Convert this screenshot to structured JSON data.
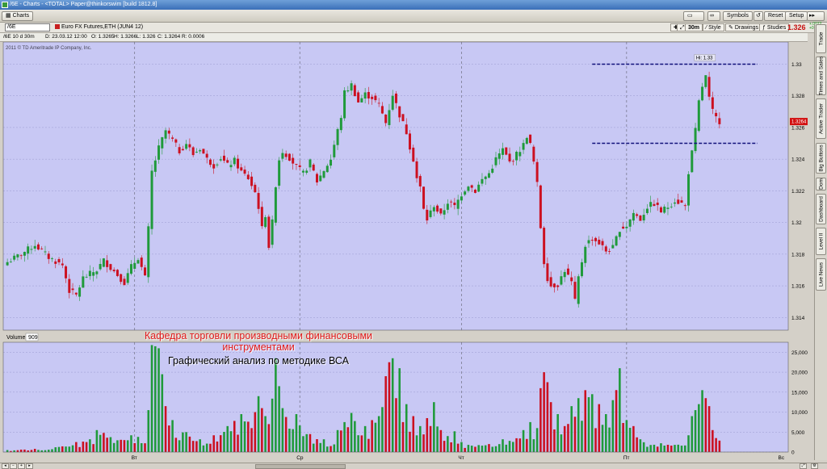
{
  "window": {
    "title": "/6E - Charts - <TOTAL> Paper@thinkorswim [build 1812.8]"
  },
  "toolbar": {
    "charts_tab": "Charts",
    "symbols_label": "Symbols",
    "reset_label": "Reset",
    "setup_label": "Setup"
  },
  "symbolbar": {
    "symbol": "/6E",
    "description": "Euro FX Futures,ETH (JUN4 12)",
    "timeframe": "30m",
    "style_label": "Style",
    "drawings_label": "Drawings",
    "studies_label": "Studies",
    "last_price": "1.326",
    "change_top": "+.0072",
    "change_bottom": "+0.55%"
  },
  "infobar": {
    "period": "/6E 10 d 30m",
    "date": "D: 23.03.12 12:00",
    "open": "O: 1.3265",
    "high": "H: 1.3266",
    "low": "L: 1.326",
    "close": "C: 1.3264",
    "range": "R: 0.0006"
  },
  "copyright": "2011 © TD Ameritrade IP Company, Inc.",
  "overlay": {
    "line1": "Кафедра торговли производными финансовыми",
    "line2": "инструментами",
    "line3": "Графический анализ по методике ВСА"
  },
  "side_tabs": [
    "Trade",
    "Times and Sales",
    "Active Trader",
    "Big Buttons",
    "Dom",
    "Dashboard",
    "Level II",
    "Live News"
  ],
  "colors": {
    "plot_bg": "#c8c8f4",
    "up": "#1f9a3a",
    "down": "#cc1020",
    "level_line": "#10107a",
    "price_badge": "#d21010"
  },
  "chart_data": {
    "type": "candlestick",
    "price_axis_ticks": [
      "1.33",
      "1.328",
      "1.326",
      "1.324",
      "1.322",
      "1.32",
      "1.318",
      "1.316",
      "1.314"
    ],
    "ylim": [
      1.3132,
      1.3314
    ],
    "current_price": "1.3264",
    "high_label": "Hi: 1.33",
    "levels": [
      1.33,
      1.325
    ],
    "day_labels": [
      "Вт",
      "Ср",
      "Чт",
      "Пт",
      "Вс"
    ],
    "volume_label": "Volume",
    "volume_value": "909",
    "volume_axis_ticks": [
      "25,000",
      "20,000",
      "15,000",
      "10,000",
      "5,000",
      "0"
    ],
    "volume_ylim": [
      0,
      27500
    ],
    "path": [
      [
        0,
        1.3175
      ],
      [
        4,
        1.318
      ],
      [
        8,
        1.3186
      ],
      [
        12,
        1.3178
      ],
      [
        16,
        1.3173
      ],
      [
        18,
        1.3157
      ],
      [
        20,
        1.3154
      ],
      [
        22,
        1.3165
      ],
      [
        26,
        1.317
      ],
      [
        28,
        1.3176
      ],
      [
        32,
        1.3167
      ],
      [
        34,
        1.3162
      ],
      [
        36,
        1.3172
      ],
      [
        38,
        1.3178
      ],
      [
        40,
        1.3165
      ],
      [
        41,
        1.3196
      ],
      [
        42,
        1.3232
      ],
      [
        44,
        1.3247
      ],
      [
        46,
        1.3258
      ],
      [
        48,
        1.3252
      ],
      [
        50,
        1.3245
      ],
      [
        52,
        1.325
      ],
      [
        54,
        1.3243
      ],
      [
        56,
        1.3247
      ],
      [
        58,
        1.324
      ],
      [
        60,
        1.3236
      ],
      [
        62,
        1.3241
      ],
      [
        64,
        1.3236
      ],
      [
        66,
        1.3239
      ],
      [
        68,
        1.3232
      ],
      [
        70,
        1.3228
      ],
      [
        72,
        1.3219
      ],
      [
        73,
        1.321
      ],
      [
        74,
        1.3196
      ],
      [
        75,
        1.3205
      ],
      [
        76,
        1.3185
      ],
      [
        77,
        1.32
      ],
      [
        78,
        1.3224
      ],
      [
        79,
        1.324
      ],
      [
        80,
        1.3245
      ],
      [
        82,
        1.3241
      ],
      [
        84,
        1.3235
      ],
      [
        86,
        1.3231
      ],
      [
        88,
        1.3238
      ],
      [
        90,
        1.3226
      ],
      [
        92,
        1.3233
      ],
      [
        94,
        1.324
      ],
      [
        96,
        1.3258
      ],
      [
        97,
        1.3267
      ],
      [
        98,
        1.3282
      ],
      [
        100,
        1.3287
      ],
      [
        102,
        1.3276
      ],
      [
        104,
        1.3281
      ],
      [
        106,
        1.3279
      ],
      [
        108,
        1.3274
      ],
      [
        110,
        1.3263
      ],
      [
        112,
        1.3281
      ],
      [
        114,
        1.3268
      ],
      [
        116,
        1.3257
      ],
      [
        117,
        1.3248
      ],
      [
        118,
        1.324
      ],
      [
        119,
        1.3228
      ],
      [
        120,
        1.3222
      ],
      [
        121,
        1.3208
      ],
      [
        122,
        1.3202
      ],
      [
        124,
        1.3211
      ],
      [
        126,
        1.3204
      ],
      [
        128,
        1.3213
      ],
      [
        130,
        1.321
      ],
      [
        132,
        1.3218
      ],
      [
        134,
        1.3224
      ],
      [
        136,
        1.322
      ],
      [
        138,
        1.3227
      ],
      [
        140,
        1.3231
      ],
      [
        142,
        1.324
      ],
      [
        144,
        1.3246
      ],
      [
        146,
        1.3238
      ],
      [
        148,
        1.3243
      ],
      [
        150,
        1.3249
      ],
      [
        151,
        1.3255
      ],
      [
        152,
        1.3249
      ],
      [
        153,
        1.3238
      ],
      [
        154,
        1.3224
      ],
      [
        155,
        1.3197
      ],
      [
        156,
        1.3175
      ],
      [
        157,
        1.3165
      ],
      [
        158,
        1.316
      ],
      [
        160,
        1.3161
      ],
      [
        162,
        1.317
      ],
      [
        164,
        1.3162
      ],
      [
        165,
        1.315
      ],
      [
        166,
        1.3165
      ],
      [
        168,
        1.3186
      ],
      [
        170,
        1.319
      ],
      [
        172,
        1.3187
      ],
      [
        174,
        1.3182
      ],
      [
        176,
        1.3184
      ],
      [
        178,
        1.3196
      ],
      [
        180,
        1.3198
      ],
      [
        182,
        1.3206
      ],
      [
        184,
        1.3202
      ],
      [
        186,
        1.321
      ],
      [
        188,
        1.3212
      ],
      [
        190,
        1.3207
      ],
      [
        192,
        1.321
      ],
      [
        194,
        1.3214
      ],
      [
        196,
        1.3212
      ],
      [
        197,
        1.321
      ],
      [
        198,
        1.3232
      ],
      [
        199,
        1.3244
      ],
      [
        200,
        1.3258
      ],
      [
        201,
        1.3276
      ],
      [
        202,
        1.3286
      ],
      [
        203,
        1.3292
      ],
      [
        204,
        1.3278
      ],
      [
        205,
        1.327
      ],
      [
        206,
        1.3266
      ],
      [
        207,
        1.3264
      ]
    ],
    "volumes": [
      [
        0,
        500
      ],
      [
        8,
        800
      ],
      [
        14,
        1200
      ],
      [
        20,
        2500
      ],
      [
        24,
        3200
      ],
      [
        26,
        5500
      ],
      [
        28,
        4800
      ],
      [
        34,
        3000
      ],
      [
        36,
        4200
      ],
      [
        38,
        3800
      ],
      [
        40,
        2200
      ],
      [
        42,
        26800
      ],
      [
        43,
        26500
      ],
      [
        44,
        26000
      ],
      [
        45,
        19500
      ],
      [
        46,
        11500
      ],
      [
        48,
        8000
      ],
      [
        52,
        5000
      ],
      [
        56,
        3200
      ],
      [
        60,
        4200
      ],
      [
        64,
        6500
      ],
      [
        66,
        7800
      ],
      [
        68,
        9500
      ],
      [
        70,
        7600
      ],
      [
        72,
        10000
      ],
      [
        73,
        14000
      ],
      [
        74,
        11000
      ],
      [
        75,
        9000
      ],
      [
        76,
        7000
      ],
      [
        78,
        23500
      ],
      [
        79,
        16500
      ],
      [
        80,
        11000
      ],
      [
        84,
        9500
      ],
      [
        88,
        4500
      ],
      [
        92,
        3200
      ],
      [
        94,
        1500
      ],
      [
        96,
        5500
      ],
      [
        98,
        7500
      ],
      [
        100,
        9800
      ],
      [
        104,
        6500
      ],
      [
        106,
        8000
      ],
      [
        108,
        9000
      ],
      [
        110,
        19000
      ],
      [
        111,
        22500
      ],
      [
        112,
        23500
      ],
      [
        113,
        13500
      ],
      [
        114,
        21000
      ],
      [
        115,
        7500
      ],
      [
        116,
        12000
      ],
      [
        118,
        9000
      ],
      [
        120,
        6500
      ],
      [
        122,
        8500
      ],
      [
        124,
        12500
      ],
      [
        126,
        5500
      ],
      [
        128,
        4000
      ],
      [
        130,
        5200
      ],
      [
        132,
        2500
      ],
      [
        134,
        1800
      ],
      [
        140,
        2000
      ],
      [
        144,
        3200
      ],
      [
        146,
        2800
      ],
      [
        150,
        5500
      ],
      [
        152,
        7500
      ],
      [
        154,
        6000
      ],
      [
        155,
        16000
      ],
      [
        156,
        20000
      ],
      [
        157,
        17500
      ],
      [
        158,
        12500
      ],
      [
        160,
        9500
      ],
      [
        162,
        6500
      ],
      [
        164,
        11500
      ],
      [
        166,
        13500
      ],
      [
        168,
        15500
      ],
      [
        170,
        14500
      ],
      [
        172,
        12000
      ],
      [
        174,
        9500
      ],
      [
        176,
        13000
      ],
      [
        178,
        21000
      ],
      [
        180,
        8000
      ],
      [
        182,
        6500
      ],
      [
        184,
        3200
      ],
      [
        190,
        2200
      ],
      [
        194,
        1800
      ],
      [
        198,
        4200
      ],
      [
        199,
        9000
      ],
      [
        200,
        10500
      ],
      [
        201,
        12000
      ],
      [
        202,
        15500
      ],
      [
        203,
        13500
      ],
      [
        204,
        11500
      ],
      [
        205,
        5500
      ],
      [
        206,
        3500
      ]
    ],
    "volume_up_indices": [
      0,
      14,
      24,
      26,
      36,
      38,
      42,
      43,
      44,
      45,
      48,
      52,
      56,
      64,
      68,
      73,
      75,
      78,
      79,
      80,
      84,
      92,
      96,
      98,
      100,
      104,
      108,
      112,
      114,
      116,
      120,
      124,
      128,
      130,
      132,
      134,
      144,
      146,
      150,
      152,
      154,
      160,
      164,
      166,
      170,
      174,
      176,
      178,
      180,
      184,
      190,
      194,
      198,
      199,
      200,
      201,
      202
    ],
    "n_bars": 208
  }
}
